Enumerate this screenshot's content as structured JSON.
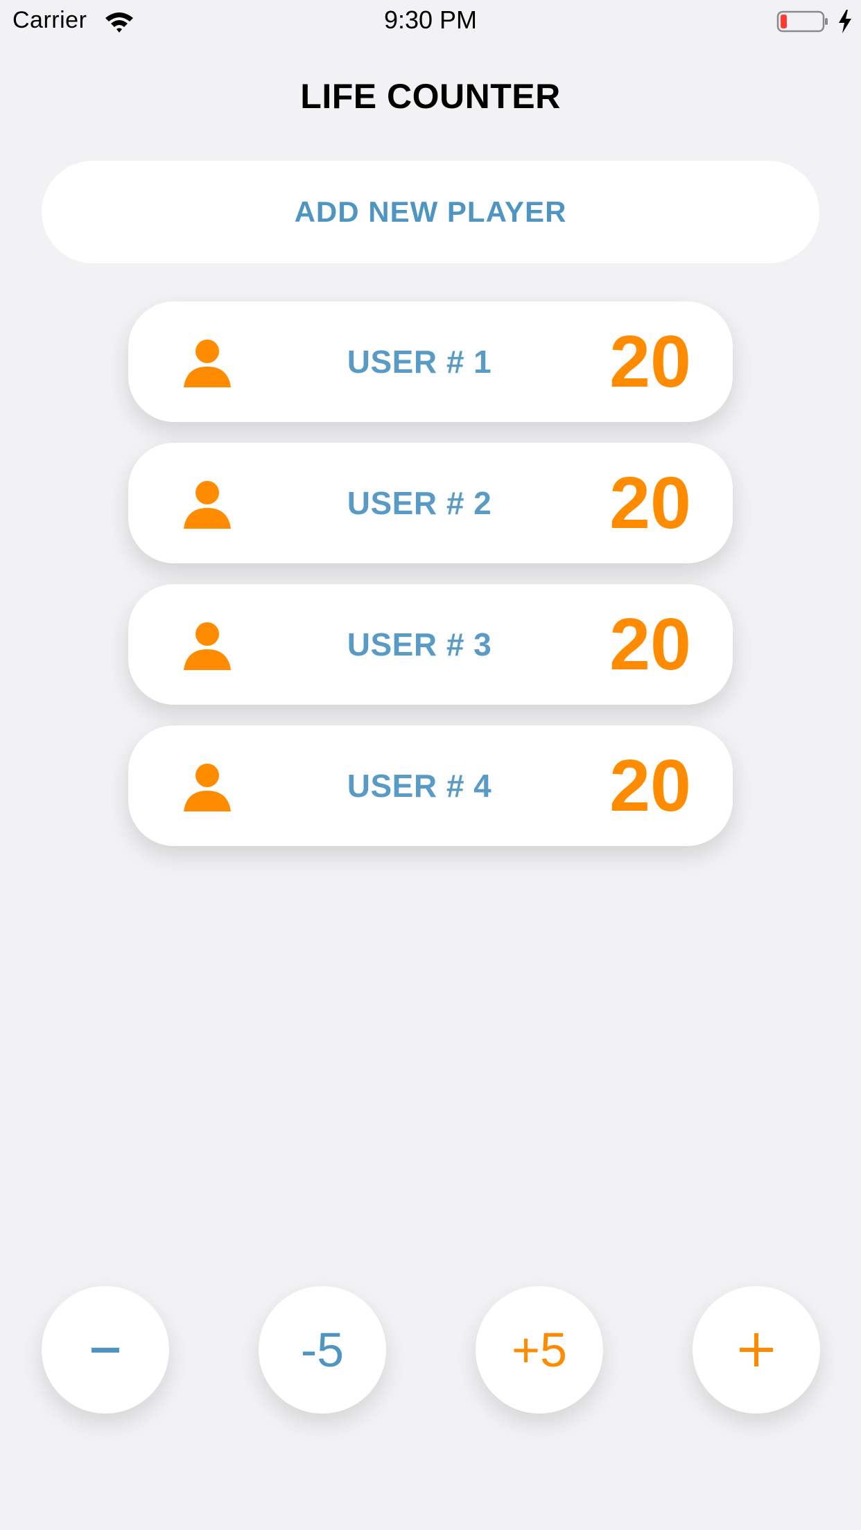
{
  "status_bar": {
    "carrier": "Carrier",
    "time": "9:30 PM",
    "wifi_icon": "wifi-icon",
    "battery_icon": "battery-low-icon",
    "charge_icon": "charging-bolt-icon"
  },
  "header": {
    "title": "LIFE COUNTER"
  },
  "add_player": {
    "label": "ADD NEW PLAYER"
  },
  "players": [
    {
      "name": "USER # 1",
      "life": "20",
      "icon": "person-icon"
    },
    {
      "name": "USER # 2",
      "life": "20",
      "icon": "person-icon"
    },
    {
      "name": "USER # 3",
      "life": "20",
      "icon": "person-icon"
    },
    {
      "name": "USER # 4",
      "life": "20",
      "icon": "person-icon"
    }
  ],
  "controls": {
    "decrement_icon": "minus-icon",
    "minus_five_label": "-5",
    "plus_five_label": "+5",
    "increment_icon": "plus-icon"
  },
  "colors": {
    "accent_blue": "#4f95c2",
    "accent_orange": "#ff8c00",
    "background": "#f2f2f4",
    "card": "#ffffff",
    "battery_low": "#ff3b30"
  }
}
